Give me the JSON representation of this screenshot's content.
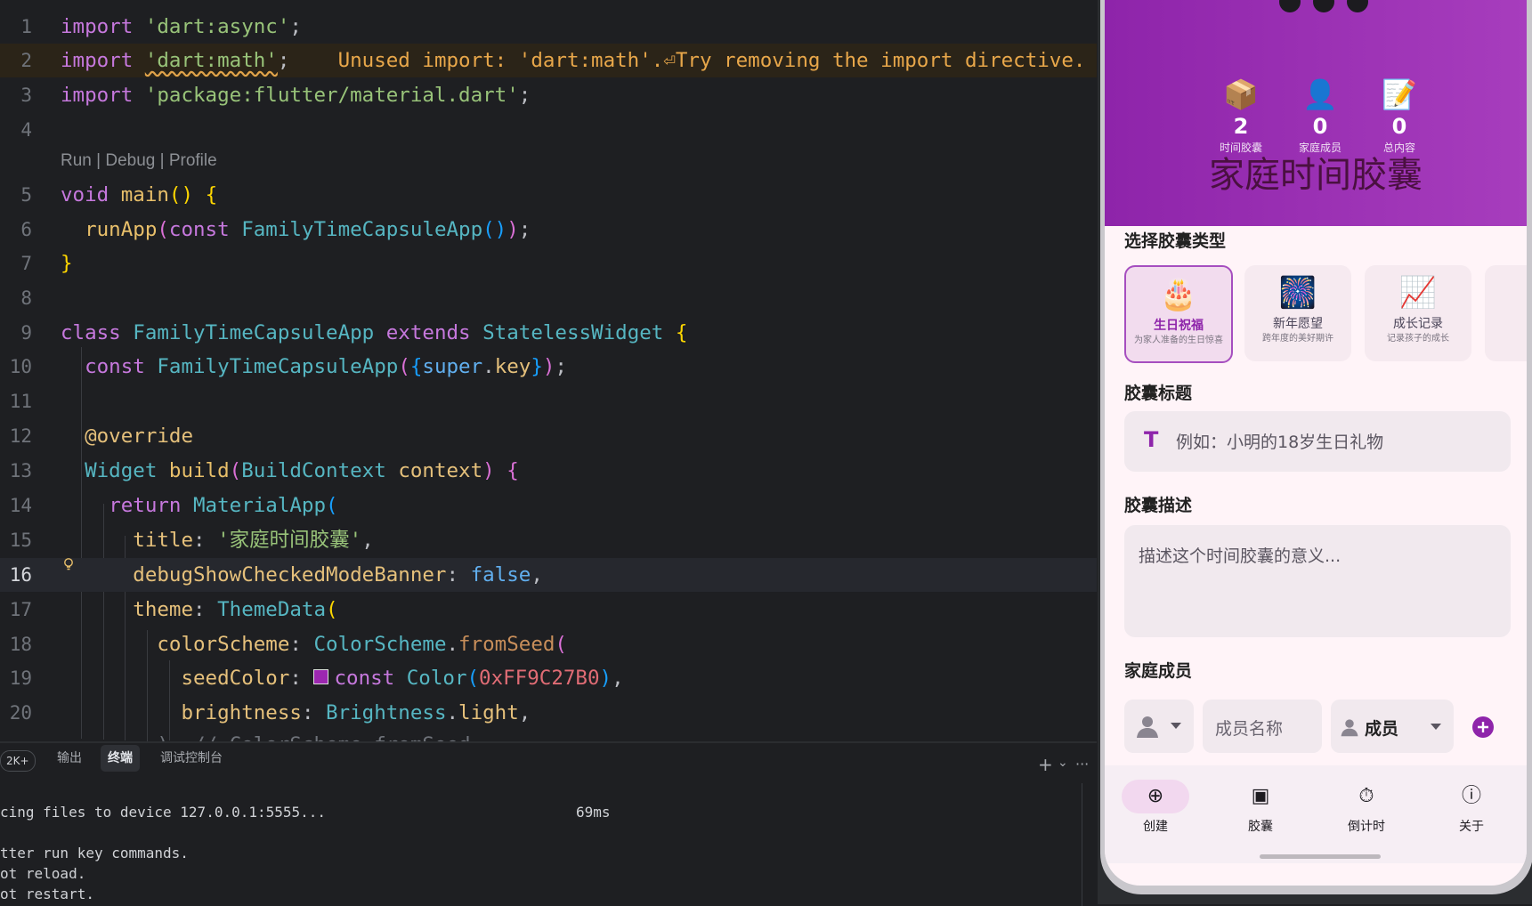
{
  "editor": {
    "line_numbers": [
      "1",
      "2",
      "3",
      "4",
      "5",
      "6",
      "7",
      "8",
      "9",
      "10",
      "11",
      "12",
      "13",
      "14",
      "15",
      "16",
      "17",
      "18",
      "19",
      "20"
    ],
    "code_lens": "Run | Debug | Profile",
    "lines": {
      "l1": {
        "kw": "import",
        "str": "'dart:async'",
        "end": ";"
      },
      "l2": {
        "kw": "import",
        "str": "'dart:math'",
        "end": ";",
        "warning": "Unused import: 'dart:math'.⏎Try removing the import directive."
      },
      "l3": {
        "kw": "import",
        "str": "'package:flutter/material.dart'",
        "end": ";"
      },
      "l5": {
        "kw": "void",
        "fn": "main",
        "p1": "()",
        "sp": " ",
        "p2": "{"
      },
      "l6": {
        "fn": "runApp",
        "p1": "(",
        "kw": "const",
        "cls": "FamilyTimeCapsuleApp",
        "p2": "()",
        "p3": ")",
        "end": ";"
      },
      "l7": {
        "p": "}"
      },
      "l9": {
        "kw": "class",
        "cls": "FamilyTimeCapsuleApp",
        "kw2": "extends",
        "cls2": "StatelessWidget",
        "p": "{"
      },
      "l10": {
        "kw": "const",
        "cls": "FamilyTimeCapsuleApp",
        "p1": "(",
        "p2": "{",
        "kw2": "super",
        "dot": ".",
        "prop": "key",
        "p3": "}",
        "p4": ")",
        "end": ";"
      },
      "l12": {
        "ann": "@override"
      },
      "l13": {
        "cls": "Widget",
        "fn": "build",
        "p1": "(",
        "cls2": "BuildContext",
        "arg": "context",
        "p2": ")",
        "p3": "{"
      },
      "l14": {
        "kw": "return",
        "cls": "MaterialApp",
        "p": "("
      },
      "l15": {
        "prop": "title",
        "colon": ":",
        "str": "'家庭时间胶囊'",
        "end": ","
      },
      "l16": {
        "prop": "debugShowCheckedModeBanner",
        "colon": ":",
        "bool": "false",
        "end": ","
      },
      "l17": {
        "prop": "theme",
        "colon": ":",
        "cls": "ThemeData",
        "p": "("
      },
      "l18": {
        "prop": "colorScheme",
        "colon": ":",
        "cls": "ColorScheme",
        "dot": ".",
        "mth": "fromSeed",
        "p": "("
      },
      "l19": {
        "prop": "seedColor",
        "colon": ":",
        "kw": "const",
        "cls": "Color",
        "p1": "(",
        "num": "0xFF9C27B0",
        "p2": ")",
        "end": ","
      },
      "l20": {
        "prop": "brightness",
        "colon": ":",
        "cls": "Brightness",
        "dot": ".",
        "prop2": "light",
        "end": ","
      },
      "l21": {
        "text": "), // ColorScheme.fromSeed"
      }
    },
    "swatch_color": "#9C27B0"
  },
  "panel": {
    "badge": "2K+",
    "tabs": [
      "输出",
      "终端",
      "调试控制台"
    ],
    "active_tab": "终端",
    "actions": {
      "add": "+",
      "chevron": "⌄",
      "more": "···"
    },
    "terminal": {
      "line1": "cing files to device 127.0.0.1:5555...",
      "line1_time": "69ms",
      "line2": "tter run key commands.",
      "line3": "ot reload.",
      "line4": "ot restart."
    }
  },
  "phone": {
    "stats": [
      {
        "icon": "📦",
        "value": "2",
        "label": "时间胶囊"
      },
      {
        "icon": "👤",
        "value": "0",
        "label": "家庭成员"
      },
      {
        "icon": "📝",
        "value": "0",
        "label": "总内容"
      }
    ],
    "app_title": "家庭时间胶囊",
    "section_type": "选择胶囊类型",
    "types": [
      {
        "icon": "🎂",
        "name": "生日祝福",
        "desc": "为家人准备的生日惊喜",
        "selected": true
      },
      {
        "icon": "🎆",
        "name": "新年愿望",
        "desc": "跨年度的美好期许",
        "selected": false
      },
      {
        "icon": "📈",
        "name": "成长记录",
        "desc": "记录孩子的成长",
        "selected": false
      }
    ],
    "section_title": "胶囊标题",
    "title_icon": "T",
    "title_placeholder": "例如：小明的18岁生日礼物",
    "section_desc": "胶囊描述",
    "desc_placeholder": "描述这个时间胶囊的意义...",
    "section_members": "家庭成员",
    "member_name_placeholder": "成员名称",
    "member_role": "成员",
    "nav": [
      {
        "label": "创建",
        "icon": "⊕",
        "active": true
      },
      {
        "label": "胶囊",
        "icon": "▣",
        "active": false
      },
      {
        "label": "倒计时",
        "icon": "⏱",
        "active": false
      },
      {
        "label": "关于",
        "icon": "ⓘ",
        "active": false
      }
    ]
  }
}
